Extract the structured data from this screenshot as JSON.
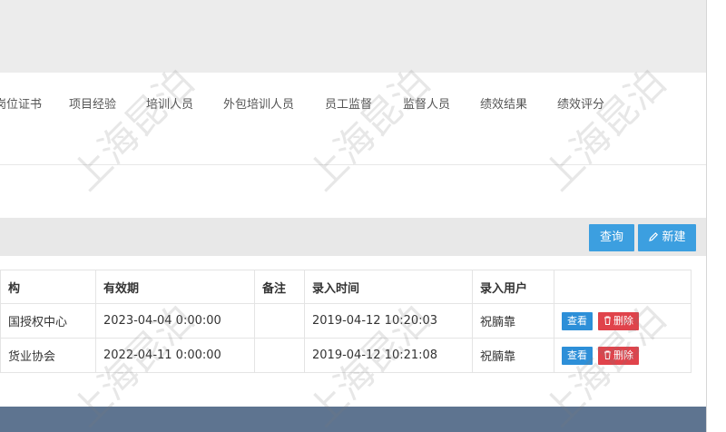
{
  "tabs": [
    "岗位证书",
    "项目经验",
    "培训人员",
    "外包培训人员",
    "员工监督",
    "监督人员",
    "绩效结果",
    "绩效评分"
  ],
  "toolbar": {
    "query_label": "查询",
    "new_label": "新建"
  },
  "table": {
    "headers": [
      "构",
      "有效期",
      "备注",
      "录入时间",
      "录入用户",
      ""
    ],
    "rows": [
      {
        "org": "国授权中心",
        "valid": "2023-04-04 0:00:00",
        "note": "",
        "entry_time": "2019-04-12 10:20:03",
        "user": "祝腩靠",
        "view": "查看",
        "delete": "删除"
      },
      {
        "org": "货业协会",
        "valid": "2022-04-11 0:00:00",
        "note": "",
        "entry_time": "2019-04-12 10:21:08",
        "user": "祝腩靠",
        "view": "查看",
        "delete": "删除"
      }
    ]
  },
  "watermark": "上海昆泊",
  "colors": {
    "button": "#3c9fe0",
    "delete": "#e0434b",
    "footer": "#5e7490"
  }
}
